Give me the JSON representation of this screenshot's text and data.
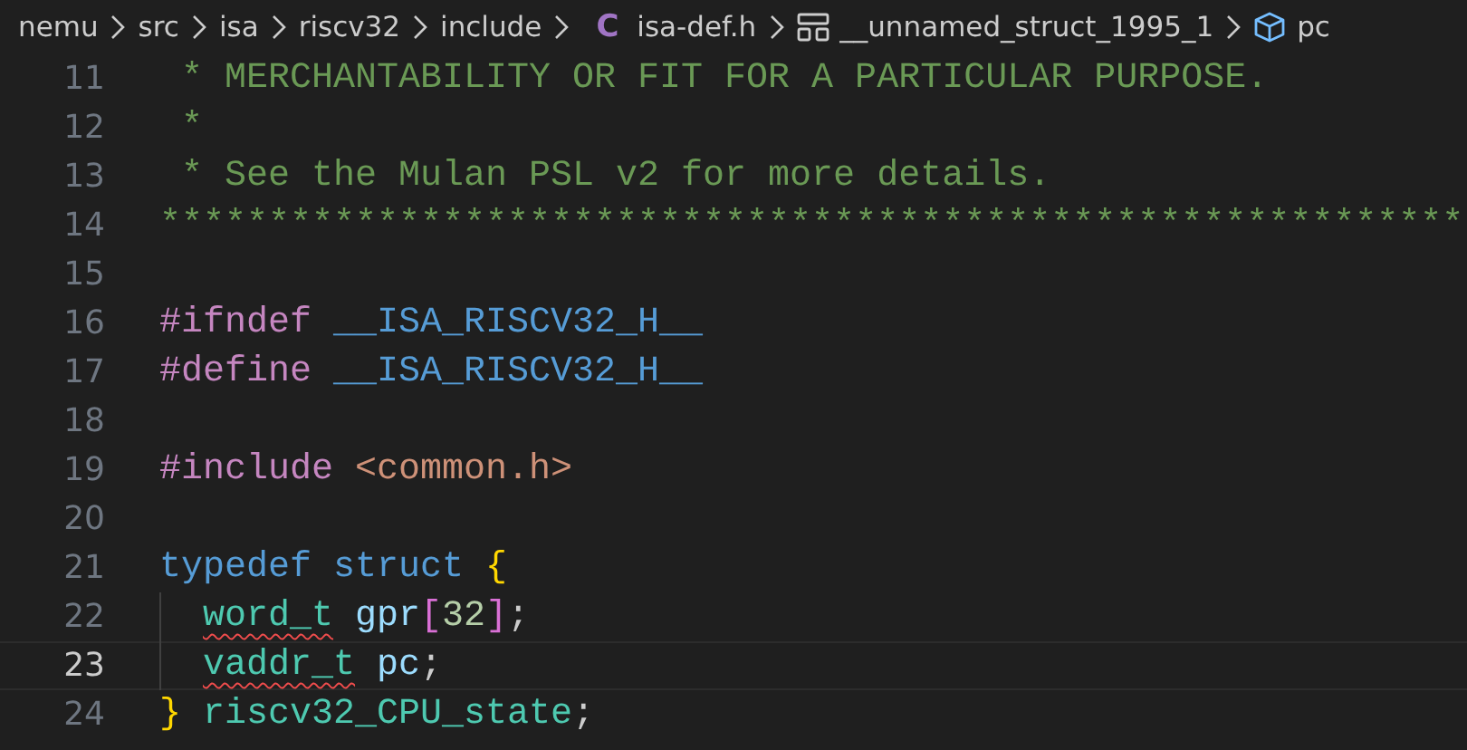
{
  "breadcrumbs": [
    {
      "label": "nemu",
      "kind": "folder"
    },
    {
      "label": "src",
      "kind": "folder"
    },
    {
      "label": "isa",
      "kind": "folder"
    },
    {
      "label": "riscv32",
      "kind": "folder"
    },
    {
      "label": "include",
      "kind": "folder"
    },
    {
      "label": "isa-def.h",
      "kind": "c-file",
      "icon": "C"
    },
    {
      "label": "__unnamed_struct_1995_1",
      "kind": "struct"
    },
    {
      "label": "pc",
      "kind": "field"
    }
  ],
  "editor": {
    "lines": [
      {
        "number": "11",
        "current": false,
        "tokens": [
          {
            "text": "* MERCHANTABILITY OR FIT FOR A PARTICULAR PURPOSE.",
            "kind": "comment",
            "space_before": true
          }
        ]
      },
      {
        "number": "12",
        "current": false,
        "tokens": [
          {
            "text": "*",
            "kind": "comment",
            "space_before": true
          }
        ]
      },
      {
        "number": "13",
        "current": false,
        "tokens": [
          {
            "text": "* See the Mulan PSL v2 for more details.",
            "kind": "comment",
            "space_before": true
          }
        ]
      },
      {
        "number": "14",
        "current": false,
        "tokens": [
          {
            "text": "************************************************************",
            "kind": "comment"
          }
        ]
      },
      {
        "number": "15",
        "current": false
      },
      {
        "number": "16",
        "current": false,
        "tokens": [
          {
            "text": "#ifndef",
            "kind": "directive"
          },
          {
            "text": "__ISA_RISCV32_H__",
            "kind": "macro",
            "space_before": true
          }
        ]
      },
      {
        "number": "17",
        "current": false,
        "tokens": [
          {
            "text": "#define",
            "kind": "directive"
          },
          {
            "text": "__ISA_RISCV32_H__",
            "kind": "macro",
            "space_before": true
          }
        ]
      },
      {
        "number": "18",
        "current": false
      },
      {
        "number": "19",
        "current": false,
        "tokens": [
          {
            "text": "#include",
            "kind": "directive"
          },
          {
            "text": "<common.h>",
            "kind": "string",
            "space_before": true
          }
        ]
      },
      {
        "number": "20",
        "current": false
      },
      {
        "number": "21",
        "current": false,
        "tokens": [
          {
            "text": "typedef struct",
            "kind": "keyword"
          },
          {
            "text": "{",
            "kind": "brace",
            "space_before": true
          }
        ]
      },
      {
        "number": "22",
        "current": false,
        "indent": true,
        "tokens": [
          {
            "text": "word_t",
            "kind": "type",
            "error": true
          },
          {
            "text": "gpr",
            "kind": "variable",
            "space_before": true
          },
          {
            "text": "[",
            "kind": "bracket"
          },
          {
            "text": "32",
            "kind": "number"
          },
          {
            "text": "]",
            "kind": "bracket"
          },
          {
            "text": ";",
            "kind": "plain"
          }
        ]
      },
      {
        "number": "23",
        "current": true,
        "indent": true,
        "tokens": [
          {
            "text": "vaddr_t",
            "kind": "type",
            "error": true
          },
          {
            "text": "pc",
            "kind": "variable",
            "space_before": true
          },
          {
            "text": ";",
            "kind": "plain"
          }
        ]
      },
      {
        "number": "24",
        "current": false,
        "tokens": [
          {
            "text": "}",
            "kind": "brace"
          },
          {
            "text": "riscv32_CPU_state",
            "kind": "type",
            "space_before": true
          },
          {
            "text": ";",
            "kind": "plain"
          }
        ]
      }
    ]
  }
}
